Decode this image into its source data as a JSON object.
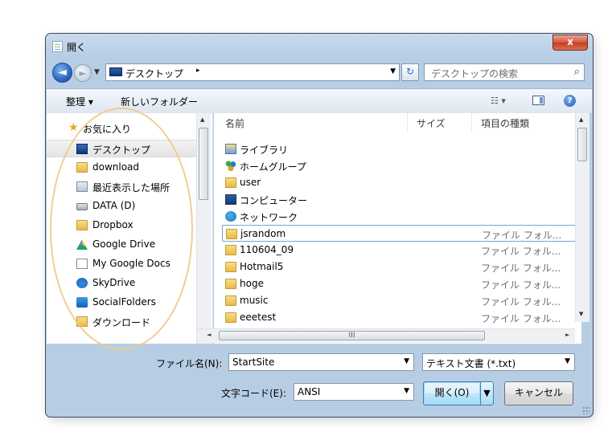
{
  "window": {
    "title": "開く",
    "close_label": "x"
  },
  "address": {
    "location": "デスクトップ",
    "separator": "▸"
  },
  "search": {
    "placeholder": "デスクトップの検索"
  },
  "toolbar": {
    "organize": "整理 ▾",
    "new_folder": "新しいフォルダー",
    "help": "?"
  },
  "nav": {
    "items": [
      {
        "label": "お気に入り",
        "icon": "star-icon"
      },
      {
        "label": "デスクトップ",
        "icon": "desktop-icon"
      },
      {
        "label": "download",
        "icon": "folder-icon"
      },
      {
        "label": "最近表示した場所",
        "icon": "recent-places-icon"
      },
      {
        "label": "DATA (D)",
        "icon": "drive-icon"
      },
      {
        "label": "Dropbox",
        "icon": "folder-icon"
      },
      {
        "label": "Google Drive",
        "icon": "google-drive-icon"
      },
      {
        "label": "My Google Docs",
        "icon": "document-icon"
      },
      {
        "label": "SkyDrive",
        "icon": "skydrive-icon"
      },
      {
        "label": "SocialFolders",
        "icon": "socialfolders-icon"
      },
      {
        "label": "ダウンロード",
        "icon": "downloads-icon"
      }
    ]
  },
  "columns": {
    "name": "名前",
    "size": "サイズ",
    "type": "項目の種類"
  },
  "files": [
    {
      "name": "ライブラリ",
      "type": "",
      "icon": "library-icon"
    },
    {
      "name": "ホームグループ",
      "type": "",
      "icon": "homegroup-icon"
    },
    {
      "name": "user",
      "type": "",
      "icon": "user-folder-icon"
    },
    {
      "name": "コンピューター",
      "type": "",
      "icon": "computer-icon"
    },
    {
      "name": "ネットワーク",
      "type": "",
      "icon": "network-icon"
    },
    {
      "name": "jsrandom",
      "type": "ファイル フォル...",
      "icon": "folder-icon"
    },
    {
      "name": "110604_09",
      "type": "ファイル フォル...",
      "icon": "folder-icon"
    },
    {
      "name": "Hotmail5",
      "type": "ファイル フォル...",
      "icon": "folder-icon"
    },
    {
      "name": "hoge",
      "type": "ファイル フォル...",
      "icon": "folder-icon"
    },
    {
      "name": "music",
      "type": "ファイル フォル...",
      "icon": "folder-icon"
    },
    {
      "name": "eeetest",
      "type": "ファイル フォル...",
      "icon": "folder-icon"
    }
  ],
  "form": {
    "filename_label": "ファイル名(N):",
    "filename_value": "StartSite",
    "filetype_value": "テキスト文書 (*.txt)",
    "encoding_label": "文字コード(E):",
    "encoding_value": "ANSI"
  },
  "buttons": {
    "open": "開く(O)",
    "cancel": "キャンセル"
  }
}
